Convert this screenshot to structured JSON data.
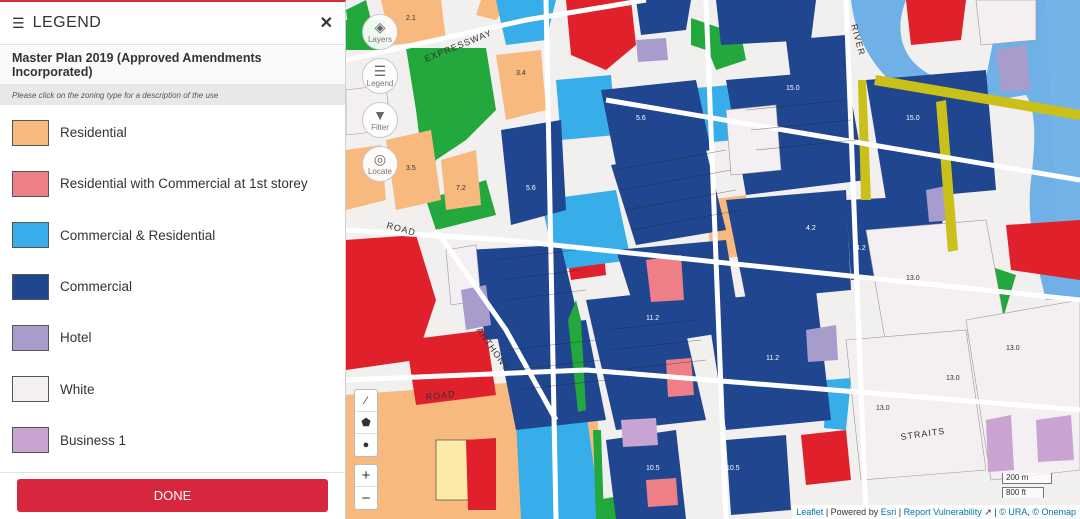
{
  "legend": {
    "title": "LEGEND",
    "close_icon": "close-icon",
    "plan_title": "Master Plan 2019 (Approved Amendments Incorporated)",
    "hint": "Please click on the zoning type for a description of the use",
    "items": [
      {
        "label": "Residential",
        "color": "#f7b97d"
      },
      {
        "label": "Residential with Commercial at 1st storey",
        "color": "#ee7f86"
      },
      {
        "label": "Commercial & Residential",
        "color": "#37aee9"
      },
      {
        "label": "Commercial",
        "color": "#20468f"
      },
      {
        "label": "Hotel",
        "color": "#a79ccc"
      },
      {
        "label": "White",
        "color": "#f4eff2"
      },
      {
        "label": "Business 1",
        "color": "#c9a3d2"
      }
    ],
    "done_label": "DONE"
  },
  "map": {
    "controls": [
      {
        "label": "Layers",
        "icon": "layers-icon"
      },
      {
        "label": "Legend",
        "icon": "legend-icon"
      },
      {
        "label": "Filter",
        "icon": "filter-icon"
      },
      {
        "label": "Locate",
        "icon": "locate-icon"
      }
    ],
    "draw_tools": [
      "line-tool-icon",
      "polygon-tool-icon",
      "point-tool-icon"
    ],
    "zoom_in": "+",
    "zoom_out": "−",
    "scale_metric": "200 m",
    "scale_imperial": "800 ft",
    "street_labels": [
      "EXPRESSWAY",
      "RIVER",
      "ROAD",
      "ROAD",
      "ANTHONY",
      "STRAITS"
    ],
    "attribution": {
      "leaflet": "Leaflet",
      "powered": "| Powered by",
      "esri": "Esri",
      "report": "Report Vulnerability",
      "ura": "© URA",
      "onemap": "© Onemap"
    },
    "colors": {
      "residential": "#f7b97d",
      "commercial": "#20468f",
      "comm_res": "#37aee9",
      "red": "#e0202a",
      "green": "#22a83c",
      "white": "#f4eff2",
      "hotel": "#a79ccc",
      "water": "#6fb1e6",
      "yellow": "#c9c01a"
    }
  }
}
